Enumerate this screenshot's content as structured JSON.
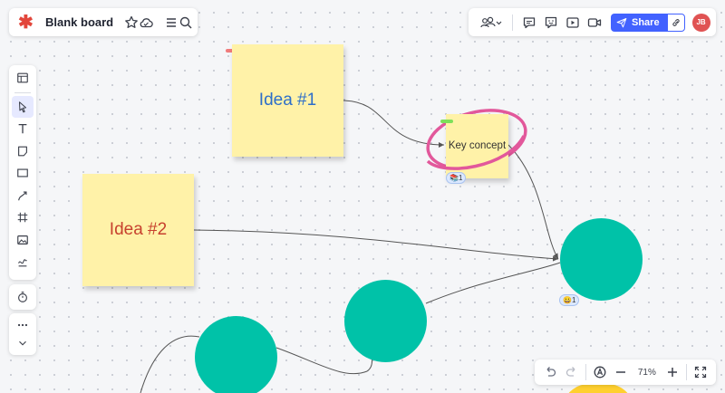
{
  "header": {
    "board_title": "Blank board",
    "share_label": "Share",
    "avatar_initials": "JB"
  },
  "canvas": {
    "stickies": [
      {
        "text": "Idea #1",
        "color": "#fff2a8",
        "text_color": "#2d6ec9"
      },
      {
        "text": "Idea #2",
        "color": "#fff2a8",
        "text_color": "#c7412e"
      },
      {
        "text": "Key concept",
        "color": "#fff2a8",
        "text_color": "#333333"
      }
    ],
    "shape_color": "#00c2a8",
    "reactions": [
      {
        "emoji": "📚",
        "count": "1"
      },
      {
        "emoji": "😀",
        "count": "1"
      }
    ],
    "highlight_color": "#e2589b"
  },
  "zoom": {
    "level": "71%"
  },
  "colors": {
    "accent": "#4262ff",
    "logo": "#e2463b"
  }
}
